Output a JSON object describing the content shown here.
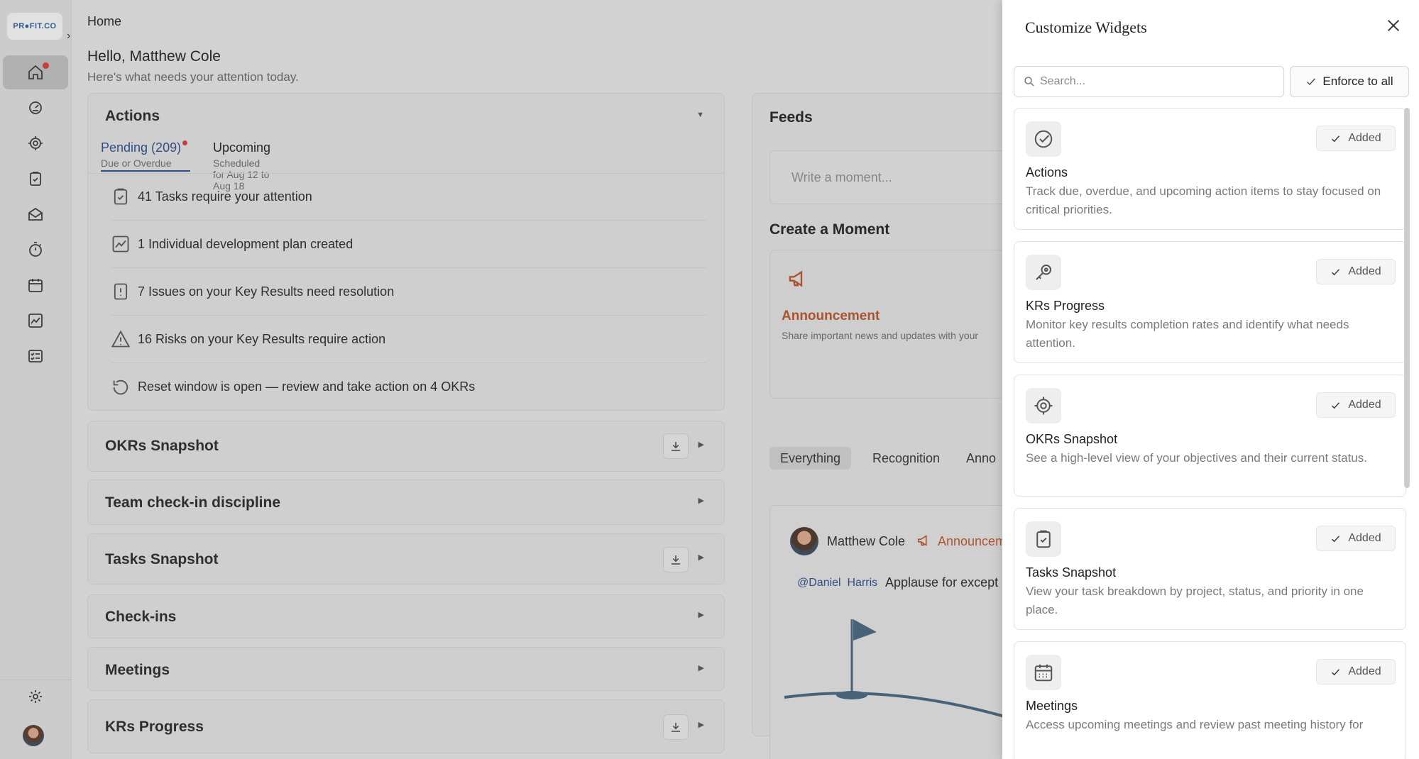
{
  "app": {
    "logo_text": "PR●FIT.CO"
  },
  "breadcrumb": "Home",
  "greeting": {
    "title": "Hello, Matthew Cole",
    "subtitle": "Here's what needs your attention today."
  },
  "actions_card": {
    "title": "Actions",
    "tabs": [
      {
        "label": "Pending (209)",
        "sub": "Due or Overdue"
      },
      {
        "label": "Upcoming",
        "sub": "Scheduled for Aug 12 to Aug 18"
      }
    ],
    "items": [
      {
        "icon": "clipboard-check-icon",
        "text": "41 Tasks require your attention"
      },
      {
        "icon": "trend-chart-icon",
        "text": "1 Individual development plan created"
      },
      {
        "icon": "exclamation-box-icon",
        "text": "7 Issues on your Key Results need resolution"
      },
      {
        "icon": "warning-triangle-icon",
        "text": "16 Risks on your Key Results require action"
      },
      {
        "icon": "reset-icon",
        "text": "Reset window is open — review and take action on 4 OKRs"
      }
    ]
  },
  "collapsed_cards": [
    {
      "title": "OKRs Snapshot",
      "download": true
    },
    {
      "title": "Team check-in discipline",
      "download": false
    },
    {
      "title": "Tasks Snapshot",
      "download": true
    },
    {
      "title": "Check-ins",
      "download": false
    },
    {
      "title": "Meetings",
      "download": false
    },
    {
      "title": "KRs Progress",
      "download": true
    }
  ],
  "feeds": {
    "title": "Feeds",
    "input_placeholder": "Write a moment...",
    "create_title": "Create a Moment",
    "announcement": {
      "title": "Announcement",
      "desc": "Share important news and updates with your"
    },
    "tabs": [
      "Everything",
      "Recognition",
      "Anno"
    ],
    "post": {
      "author": "Matthew Cole",
      "type": "Announcem",
      "mention": "@Daniel  Harris",
      "text": "Applause for except"
    }
  },
  "panel": {
    "title": "Customize Widgets",
    "search_placeholder": "Search...",
    "enforce_label": "Enforce to all",
    "added_label": "Added",
    "widgets": [
      {
        "icon": "check-circle-icon",
        "name": "Actions",
        "desc": "Track due, overdue, and upcoming action items to stay focused on critical priorities."
      },
      {
        "icon": "key-icon",
        "name": "KRs Progress",
        "desc": "Monitor key results completion rates and identify what needs attention."
      },
      {
        "icon": "target-icon",
        "name": "OKRs Snapshot",
        "desc": "See a high-level view of your objectives and their current status."
      },
      {
        "icon": "clipboard-check-icon",
        "name": "Tasks Snapshot",
        "desc": "View your task breakdown by project, status, and priority in one place."
      },
      {
        "icon": "calendar-icon",
        "name": "Meetings",
        "desc": "Access upcoming meetings and review past meeting history for"
      }
    ]
  },
  "colors": {
    "accent": "#2c4d8a",
    "announcement": "#b7532a",
    "notification": "#d63b3b"
  }
}
